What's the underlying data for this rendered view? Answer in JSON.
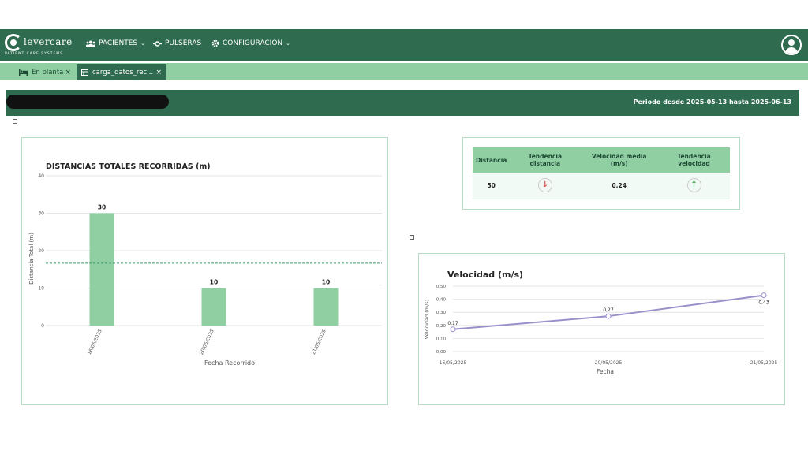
{
  "app": {
    "logo_text": "levercare",
    "logo_sub": "PATIENT CARE SYSTEMS",
    "nav": [
      {
        "label": "PACIENTES",
        "icon": "users-icon",
        "dropdown": true
      },
      {
        "label": "PULSERAS",
        "icon": "wristband-icon",
        "dropdown": false
      },
      {
        "label": "CONFIGURACIÓN",
        "icon": "gear-icon",
        "dropdown": true
      }
    ],
    "tabs": [
      {
        "label": "En planta",
        "icon": "bed-icon",
        "close": "×"
      },
      {
        "label": "carga_datos_rec...",
        "icon": "table-icon",
        "close": "×"
      }
    ]
  },
  "header": {
    "period": "Periodo desde 2025-05-13 hasta 2025-06-13"
  },
  "metrics": {
    "headers": [
      "Distancia",
      "Tendencia distancia",
      "Velocidad media (m/s)",
      "Tendencia velocidad"
    ],
    "row": {
      "distance": "50",
      "distance_trend": "↓",
      "speed": "0,24",
      "speed_trend": "↑"
    }
  },
  "chart_data": [
    {
      "type": "bar",
      "title": "DISTANCIAS TOTALES RECORRIDAS (m)",
      "xlabel": "Fecha Recorrido",
      "ylabel": "Distancia Total (m)",
      "categories": [
        "16/05/2025",
        "20/05/2025",
        "21/05/2025"
      ],
      "values": [
        30,
        10,
        10
      ],
      "ylim": [
        0,
        40
      ],
      "yticks": [
        "0",
        "10",
        "20",
        "30",
        "40"
      ],
      "reference_line": 16.67,
      "color": "#8fcfa1"
    },
    {
      "type": "line",
      "title": "Velocidad (m/s)",
      "xlabel": "Fecha",
      "ylabel": "Velocidad (m/s)",
      "categories": [
        "16/05/2025",
        "20/05/2025",
        "21/05/2025"
      ],
      "values": [
        0.17,
        0.27,
        0.43
      ],
      "value_labels": [
        "0,17",
        "0,27",
        "0,43"
      ],
      "ylim": [
        0,
        0.5
      ],
      "yticks": [
        "0,00",
        "0,10",
        "0,20",
        "0,30",
        "0,40",
        "0,50"
      ],
      "color": "#9b8fc9"
    }
  ]
}
